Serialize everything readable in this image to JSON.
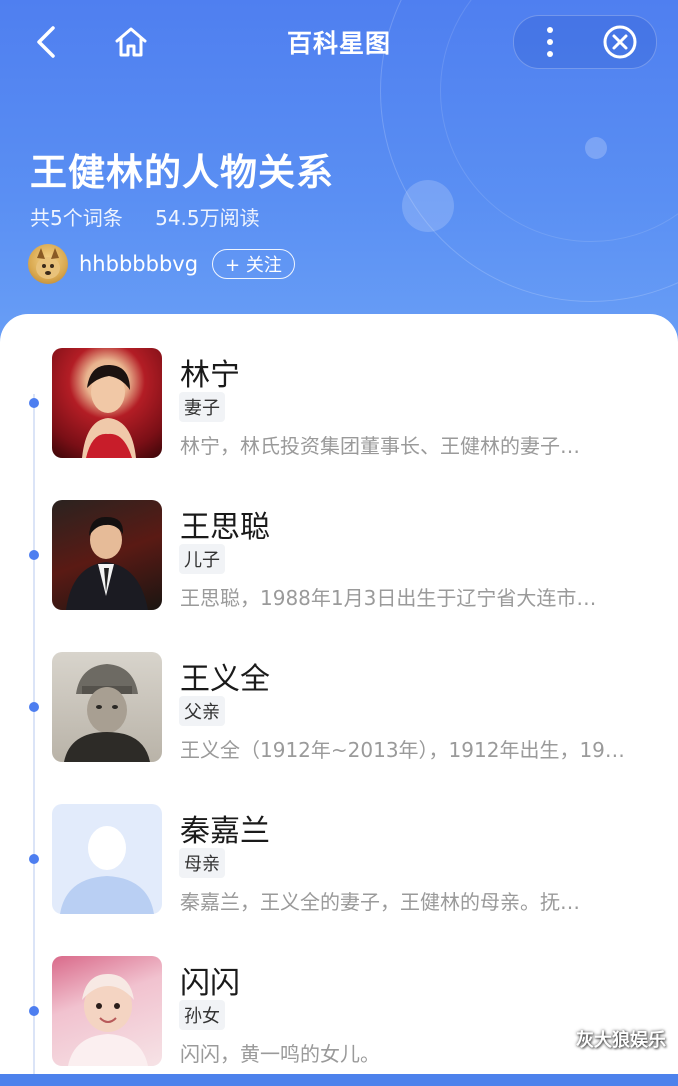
{
  "nav": {
    "title": "百科星图",
    "back_icon": "chevron-left-icon",
    "home_icon": "home-icon",
    "more_icon": "more-vertical-icon",
    "close_icon": "close-circle-icon"
  },
  "hero": {
    "title": "王健林的人物关系",
    "entries": "共5个词条",
    "reads": "54.5万阅读",
    "author": "hhbbbbbvg",
    "follow_label": "+ 关注"
  },
  "people": [
    {
      "name": "林宁",
      "relation": "妻子",
      "desc": "林宁，林氏投资集团董事长、王健林的妻子…",
      "photo": "woman-portrait-red"
    },
    {
      "name": "王思聪",
      "relation": "儿子",
      "desc": "王思聪，1988年1月3日出生于辽宁省大连市…",
      "photo": "man-portrait-suit"
    },
    {
      "name": "王义全",
      "relation": "父亲",
      "desc": "王义全（1912年~2013年），1912年出生，19…",
      "photo": "old-man-bw-portrait"
    },
    {
      "name": "秦嘉兰",
      "relation": "母亲",
      "desc": "秦嘉兰，王义全的妻子，王健林的母亲。抚…",
      "photo": "default-avatar"
    },
    {
      "name": "闪闪",
      "relation": "孙女",
      "desc": "闪闪，黄一鸣的女儿。",
      "photo": "baby-portrait"
    }
  ],
  "watermark": "灰大狼娱乐",
  "colors": {
    "accent": "#4d7ef0",
    "header_top": "#4f7ff0",
    "header_bottom": "#6aa0f6"
  }
}
